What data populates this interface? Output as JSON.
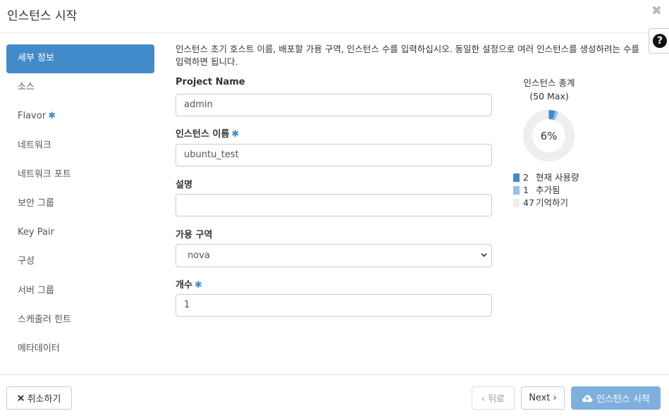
{
  "modal": {
    "title": "인스턴스 시작",
    "close_glyph": "✖",
    "help_glyph": "?"
  },
  "sidebar": {
    "items": [
      {
        "label": "세부 정보",
        "active": true,
        "required": false
      },
      {
        "label": "소스",
        "active": false,
        "required": false
      },
      {
        "label": "Flavor",
        "active": false,
        "required": true
      },
      {
        "label": "네트워크",
        "active": false,
        "required": false
      },
      {
        "label": "네트워크 포트",
        "active": false,
        "required": false
      },
      {
        "label": "보안 그룹",
        "active": false,
        "required": false
      },
      {
        "label": "Key Pair",
        "active": false,
        "required": false
      },
      {
        "label": "구성",
        "active": false,
        "required": false
      },
      {
        "label": "서버 그룹",
        "active": false,
        "required": false
      },
      {
        "label": "스케줄러 힌트",
        "active": false,
        "required": false
      },
      {
        "label": "메타데이터",
        "active": false,
        "required": false
      }
    ]
  },
  "form": {
    "description": "인스턴스 초기 호스트 이름, 배포할 가용 구역, 인스턴스 수를 입력하십시오. 동일한 설정으로 여러 인스턴스를 생성하려는 수를 입력하면 됩니다.",
    "project_name_label": "Project Name",
    "project_name_value": "admin",
    "instance_name_label": "인스턴스 이름",
    "instance_name_value": "ubuntu_test",
    "description_label": "설명",
    "description_value": "",
    "az_label": "가용 구역",
    "az_value": "nova",
    "count_label": "개수",
    "count_value": "1",
    "required_mark": "✱"
  },
  "quota": {
    "title": "인스턴스 총계",
    "subtitle": "(50 Max)",
    "percent_label": "6%",
    "max": 50,
    "legend": [
      {
        "value": "2",
        "label": "현재 사용량",
        "color": "#428bca"
      },
      {
        "value": "1",
        "label": "추가됨",
        "color": "#95bfe6"
      },
      {
        "value": "47",
        "label": "기억하기",
        "color": "#efefef"
      }
    ]
  },
  "footer": {
    "cancel_label": "취소하기",
    "back_label": "‹ 뒤로",
    "next_label": "Next ›",
    "launch_label": "인스턴스 시작"
  },
  "colors": {
    "accent": "#428bca",
    "launch_button": "#7fb0dd",
    "donut_track": "#eeeeee"
  }
}
